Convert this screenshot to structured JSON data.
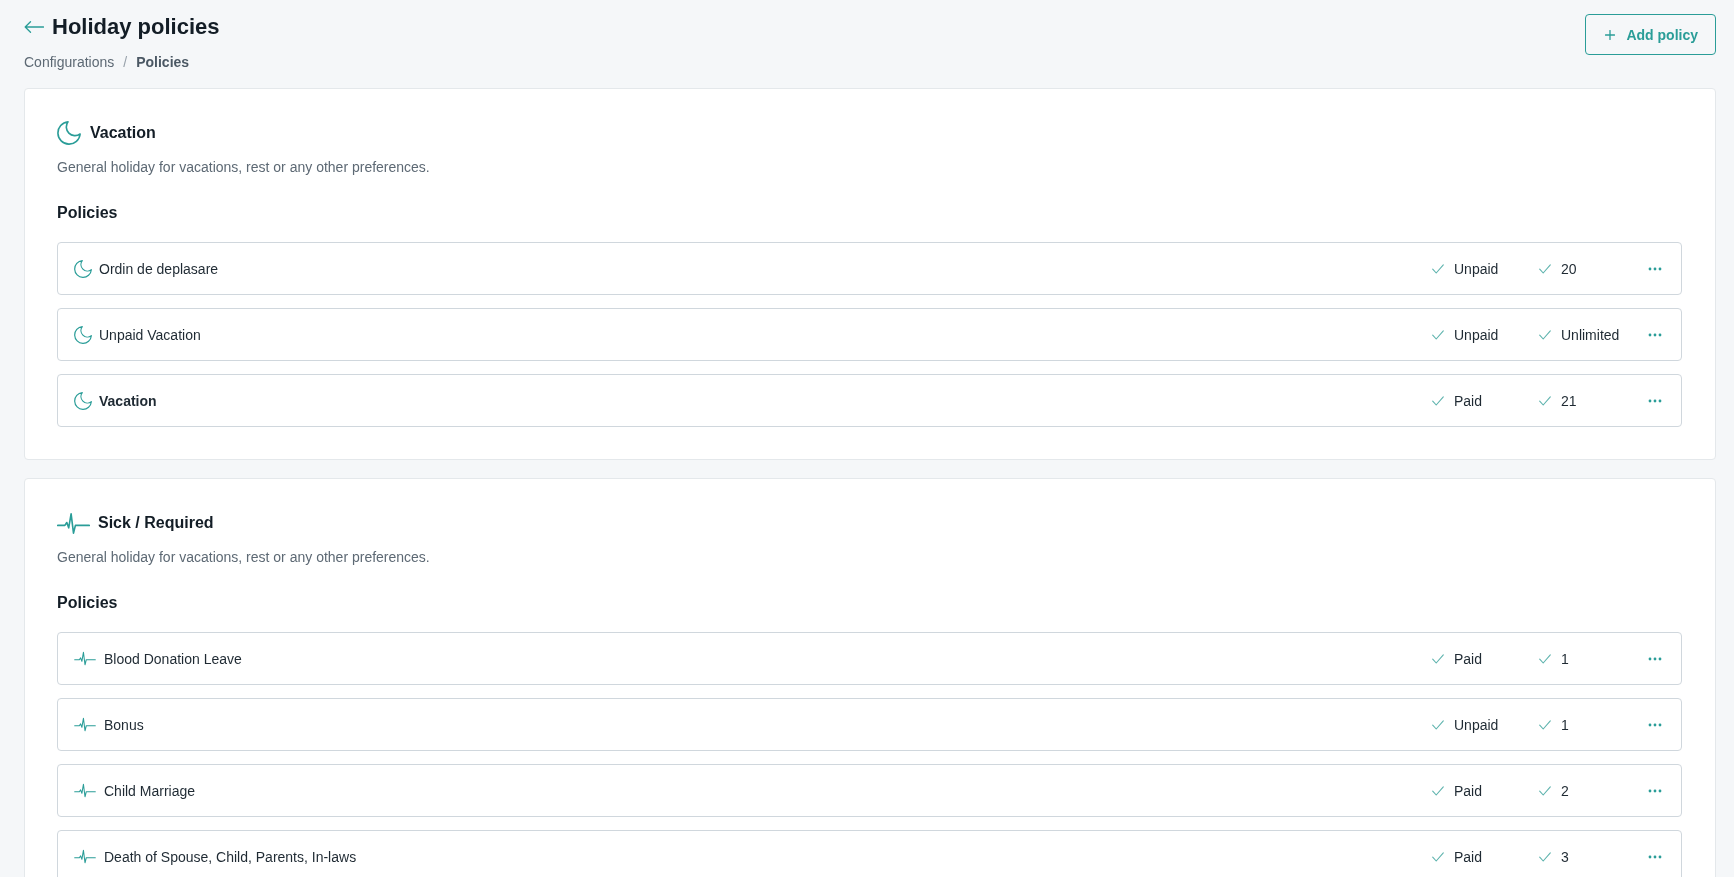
{
  "header": {
    "title": "Holiday policies",
    "breadcrumb": {
      "separator": "/",
      "items": [
        {
          "label": "Configurations",
          "current": false
        },
        {
          "label": "Policies",
          "current": true
        }
      ]
    },
    "add_button": {
      "label": "Add policy"
    }
  },
  "categories": [
    {
      "kind": "vacation",
      "title": "Vacation",
      "description": "General holiday for vacations, rest or any other preferences.",
      "policies_heading": "Policies",
      "policies": [
        {
          "name": "Ordin de deplasare",
          "emphasized": false,
          "payment": "Unpaid",
          "allowance": "20"
        },
        {
          "name": "Unpaid Vacation",
          "emphasized": false,
          "payment": "Unpaid",
          "allowance": "Unlimited"
        },
        {
          "name": "Vacation",
          "emphasized": true,
          "payment": "Paid",
          "allowance": "21"
        }
      ]
    },
    {
      "kind": "sick",
      "title": "Sick / Required",
      "description": "General holiday for vacations, rest or any other preferences.",
      "policies_heading": "Policies",
      "policies": [
        {
          "name": "Blood Donation Leave",
          "emphasized": false,
          "payment": "Paid",
          "allowance": "1"
        },
        {
          "name": "Bonus",
          "emphasized": false,
          "payment": "Unpaid",
          "allowance": "1"
        },
        {
          "name": "Child Marriage",
          "emphasized": false,
          "payment": "Paid",
          "allowance": "2"
        },
        {
          "name": "Death of Spouse, Child, Parents, In-laws",
          "emphasized": false,
          "payment": "Paid",
          "allowance": "3"
        }
      ]
    }
  ]
}
